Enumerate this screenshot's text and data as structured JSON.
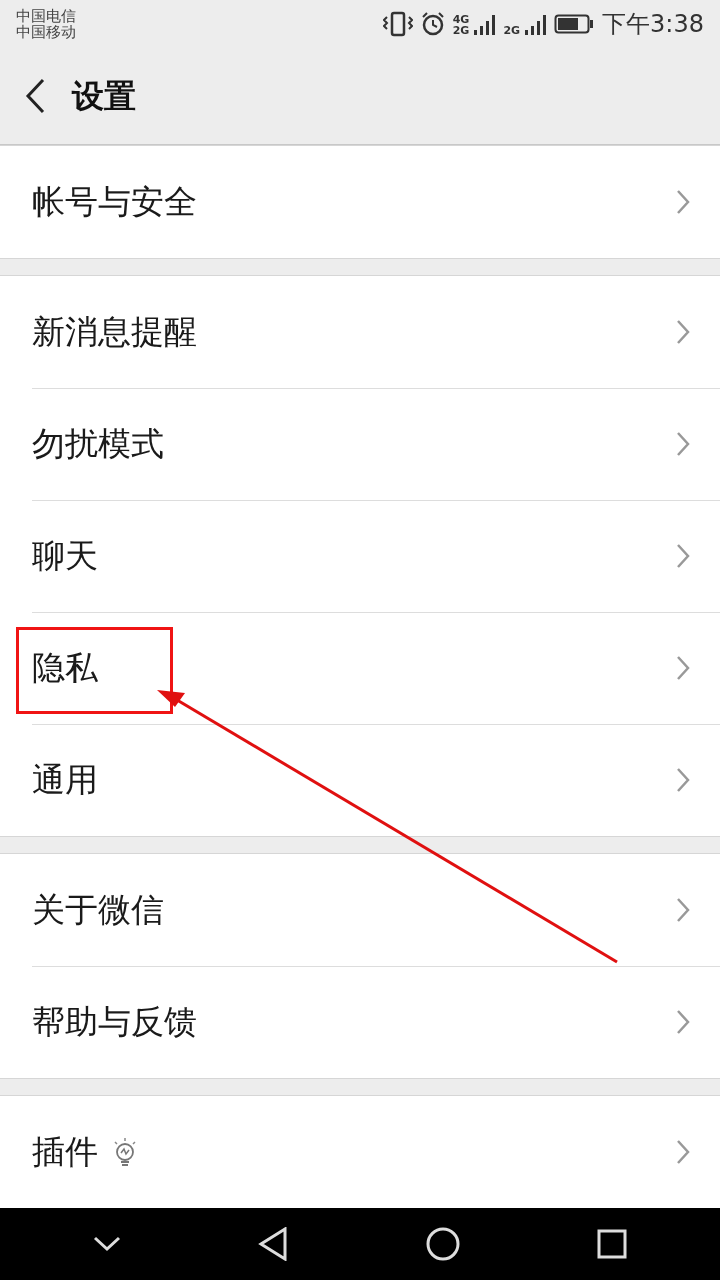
{
  "status_bar": {
    "carriers": [
      "中国电信",
      "中国移动"
    ],
    "network_labels": [
      "4G",
      "2G",
      "2G"
    ],
    "time": "下午3:38"
  },
  "header": {
    "title": "设置"
  },
  "groups": [
    {
      "items": [
        {
          "label": "帐号与安全",
          "highlighted": false,
          "icon": false
        }
      ]
    },
    {
      "items": [
        {
          "label": "新消息提醒",
          "highlighted": false,
          "icon": false
        },
        {
          "label": "勿扰模式",
          "highlighted": false,
          "icon": false
        },
        {
          "label": "聊天",
          "highlighted": false,
          "icon": false
        },
        {
          "label": "隐私",
          "highlighted": true,
          "icon": false
        },
        {
          "label": "通用",
          "highlighted": false,
          "icon": false
        }
      ]
    },
    {
      "items": [
        {
          "label": "关于微信",
          "highlighted": false,
          "icon": false
        },
        {
          "label": "帮助与反馈",
          "highlighted": false,
          "icon": false
        }
      ]
    },
    {
      "items": [
        {
          "label": "插件",
          "highlighted": false,
          "icon": true
        }
      ]
    }
  ]
}
